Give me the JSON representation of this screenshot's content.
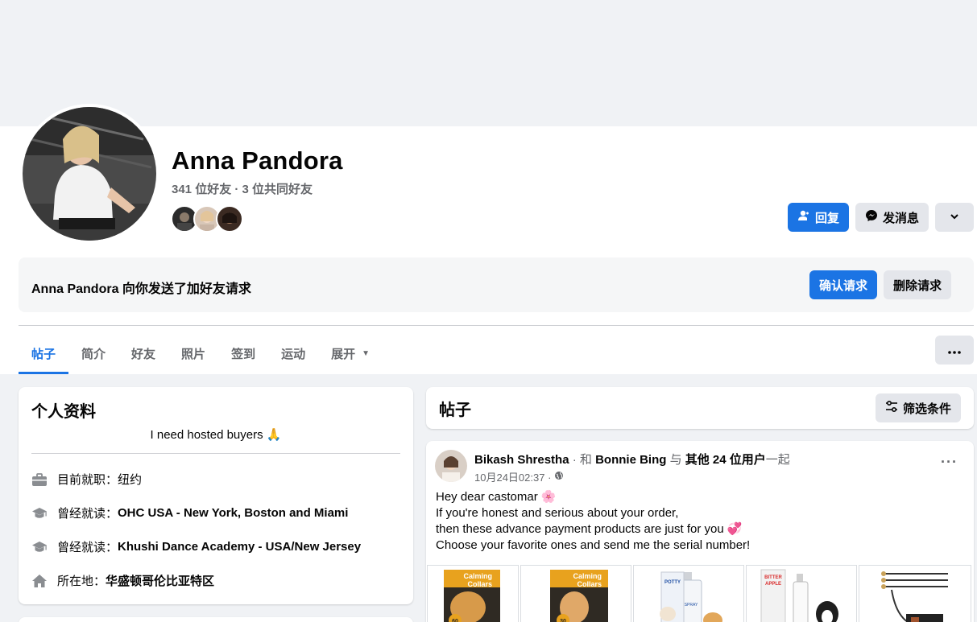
{
  "profile": {
    "name": "Anna Pandora",
    "friends_summary": "341 位好友 · 3 位共同好友"
  },
  "actions": {
    "reply_label": "回复",
    "message_label": "发消息"
  },
  "friend_request": {
    "text": "Anna Pandora 向你发送了加好友请求",
    "confirm_label": "确认请求",
    "delete_label": "删除请求"
  },
  "tabs": [
    {
      "label": "帖子",
      "active": true
    },
    {
      "label": "简介"
    },
    {
      "label": "好友"
    },
    {
      "label": "照片"
    },
    {
      "label": "签到"
    },
    {
      "label": "运动"
    },
    {
      "label": "展开"
    }
  ],
  "intro": {
    "title": "个人资料",
    "bio": "I need hosted buyers 🙏",
    "items": [
      {
        "icon": "briefcase-icon",
        "prefix": "目前就职：",
        "value": "纽约",
        "bold": false
      },
      {
        "icon": "graduation-cap-icon",
        "prefix": "曾经就读：",
        "value": "OHC USA - New York, Boston and Miami",
        "bold": true
      },
      {
        "icon": "graduation-cap-icon",
        "prefix": "曾经就读：",
        "value": "Khushi Dance Academy - USA/New Jersey",
        "bold": true
      },
      {
        "icon": "home-icon",
        "prefix": "所在地：",
        "value": "华盛顿哥伦比亚特区",
        "bold": true
      }
    ]
  },
  "posts_section": {
    "title": "帖子",
    "filter_label": "筛选条件"
  },
  "post": {
    "author": "Bikash Shrestha",
    "with_word": "和",
    "tagged": "Bonnie Bing",
    "with_word2": "与",
    "others": "其他 24 位用户",
    "together": "一起",
    "time": "10月24日02:37 ·",
    "lines": [
      "Hey dear castomar 🌸",
      "If you're honest and serious about your order,",
      "then these advance payment products are just for you 💞",
      "Choose your favorite ones and send me the serial number!"
    ]
  },
  "gallery": [
    {
      "top": "Calming",
      "bottom": "Collars",
      "badge": "60"
    },
    {
      "top": "Calming",
      "bottom": "Collars",
      "badge": "30"
    },
    {
      "top": "POTTY",
      "bottom": "SPRAY",
      "badge": ""
    },
    {
      "top": "BITTER",
      "bottom": "APPLE",
      "badge": ""
    },
    {
      "top": "",
      "bottom": "",
      "badge": ""
    }
  ],
  "colors": {
    "primary": "#1b74e4",
    "grey_button": "#e4e6eb",
    "page_bg": "#f0f2f5"
  }
}
